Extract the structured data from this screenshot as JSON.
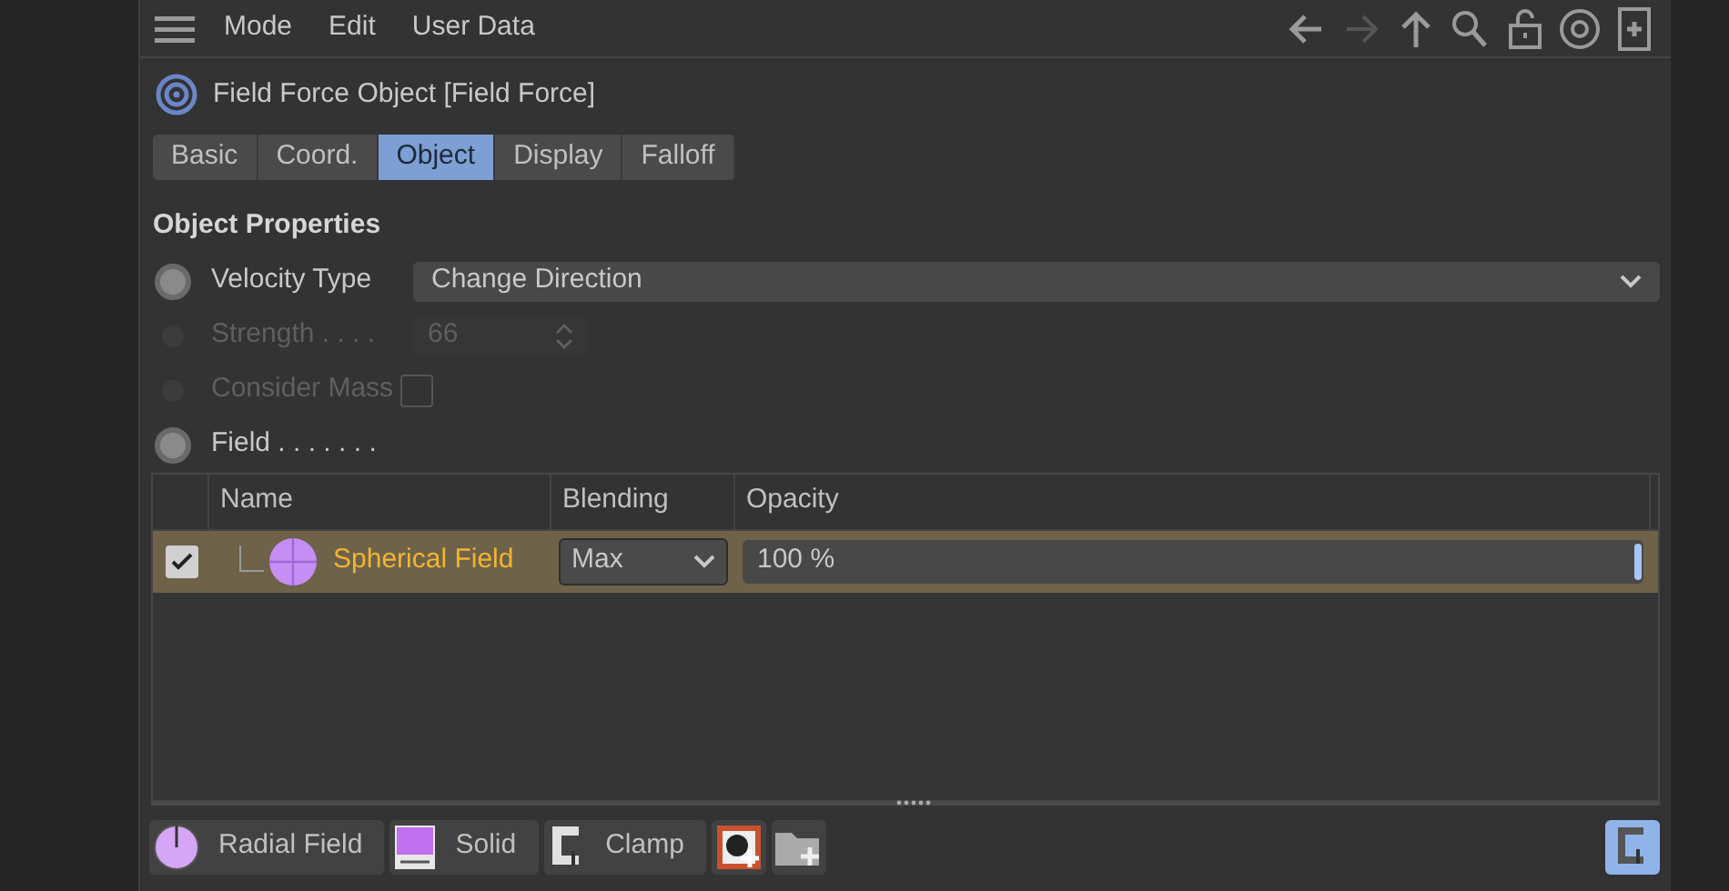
{
  "menu": [
    "Mode",
    "Edit",
    "User Data"
  ],
  "nav": [
    {
      "kind": "back",
      "disabled": false
    },
    {
      "kind": "forward",
      "disabled": true
    },
    {
      "kind": "up",
      "disabled": false
    },
    {
      "kind": "search",
      "disabled": false
    },
    {
      "kind": "lock",
      "disabled": false
    },
    {
      "kind": "target",
      "disabled": false
    },
    {
      "kind": "new",
      "disabled": false
    }
  ],
  "object_title": "Field Force Object [Field Force]",
  "tabs": [
    {
      "label": "Basic",
      "selected": false
    },
    {
      "label": "Coord.",
      "selected": false
    },
    {
      "label": "Object",
      "selected": true
    },
    {
      "label": "Display",
      "selected": false
    },
    {
      "label": "Falloff",
      "selected": false
    }
  ],
  "section_title": "Object Properties",
  "properties": [
    {
      "kind": "dropdown",
      "label": "Velocity Type",
      "value": "Change Direction",
      "disabled": false
    },
    {
      "kind": "number",
      "label": "Strength . . . .",
      "value": "66",
      "disabled": true
    },
    {
      "kind": "checkbox",
      "label": "Consider Mass",
      "checked": false,
      "disabled": true
    },
    {
      "kind": "field",
      "label": "Field . . . . . . .",
      "disabled": false
    }
  ],
  "field_list": {
    "columns": [
      "Name",
      "Blending",
      "Opacity"
    ],
    "rows": [
      {
        "enabled": true,
        "selected": true,
        "name": "Spherical Field",
        "blending": "Max",
        "opacity": "100 %",
        "level": 1
      }
    ]
  },
  "toolbar": [
    {
      "kind": "radial",
      "label": "Radial Field"
    },
    {
      "kind": "solid",
      "label": "Solid"
    },
    {
      "kind": "clamp",
      "label": "Clamp"
    },
    {
      "kind": "add-layer"
    },
    {
      "kind": "add-folder"
    }
  ],
  "clamp_toggle": {
    "selected": true
  }
}
